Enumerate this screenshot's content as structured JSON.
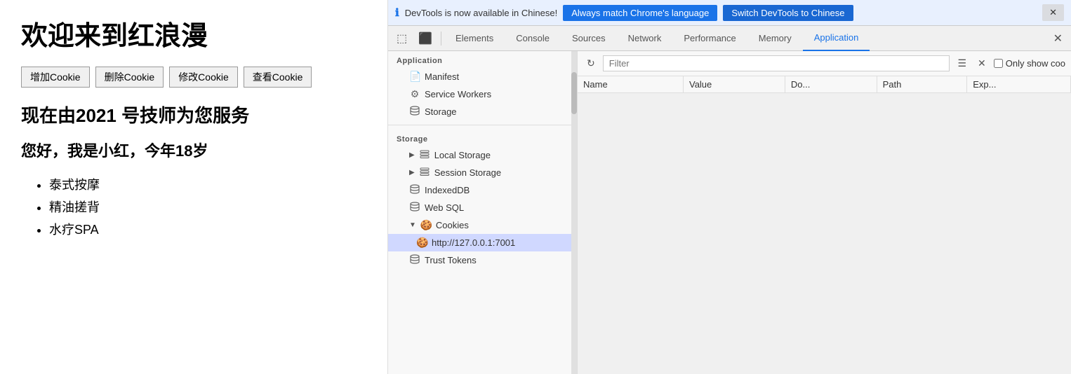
{
  "webpage": {
    "title": "欢迎来到红浪漫",
    "buttons": [
      {
        "label": "增加Cookie",
        "name": "add-cookie-btn"
      },
      {
        "label": "删除Cookie",
        "name": "delete-cookie-btn"
      },
      {
        "label": "修改Cookie",
        "name": "modify-cookie-btn"
      },
      {
        "label": "查看Cookie",
        "name": "view-cookie-btn"
      }
    ],
    "subtitle": "现在由2021 号技师为您服务",
    "greeting": "您好，我是小红，今年18岁",
    "services": [
      "泰式按摩",
      "精油搓背",
      "水疗SPA"
    ]
  },
  "devtools": {
    "banner": {
      "info_text": "DevTools is now available in Chinese!",
      "btn1_label": "Always match Chrome's language",
      "btn2_label": "Switch DevTools to Chinese",
      "close_label": "✕"
    },
    "tabs": [
      {
        "label": "Elements",
        "name": "tab-elements",
        "active": false
      },
      {
        "label": "Console",
        "name": "tab-console",
        "active": false
      },
      {
        "label": "Sources",
        "name": "tab-sources",
        "active": false
      },
      {
        "label": "Network",
        "name": "tab-network",
        "active": false
      },
      {
        "label": "Performance",
        "name": "tab-performance",
        "active": false
      },
      {
        "label": "Memory",
        "name": "tab-memory",
        "active": false
      },
      {
        "label": "Application",
        "name": "tab-application",
        "active": true
      }
    ],
    "sidebar": {
      "section1_label": "Application",
      "items_section1": [
        {
          "label": "Manifest",
          "icon": "📄",
          "indent": 1
        },
        {
          "label": "Service Workers",
          "icon": "⚙️",
          "indent": 1
        },
        {
          "label": "Storage",
          "icon": "🗄️",
          "indent": 1
        }
      ],
      "section2_label": "Storage",
      "items_section2": [
        {
          "label": "Local Storage",
          "icon": "▶",
          "has_arrow": true,
          "indent": 1
        },
        {
          "label": "Session Storage",
          "icon": "▶",
          "has_arrow": true,
          "indent": 1
        },
        {
          "label": "IndexedDB",
          "icon": "🗄️",
          "indent": 1
        },
        {
          "label": "Web SQL",
          "icon": "🗄️",
          "indent": 1
        },
        {
          "label": "Cookies",
          "icon": "▼",
          "has_arrow": true,
          "expanded": true,
          "indent": 1
        },
        {
          "label": "http://127.0.0.1:7001",
          "icon": "🍪",
          "indent": 2,
          "active": true
        },
        {
          "label": "Trust Tokens",
          "icon": "🗄️",
          "indent": 1
        }
      ]
    },
    "toolbar": {
      "filter_placeholder": "Filter",
      "only_show_label": "Only show coo"
    },
    "table": {
      "columns": [
        "Name",
        "Value",
        "Do...",
        "Path",
        "Exp..."
      ],
      "rows": []
    }
  }
}
